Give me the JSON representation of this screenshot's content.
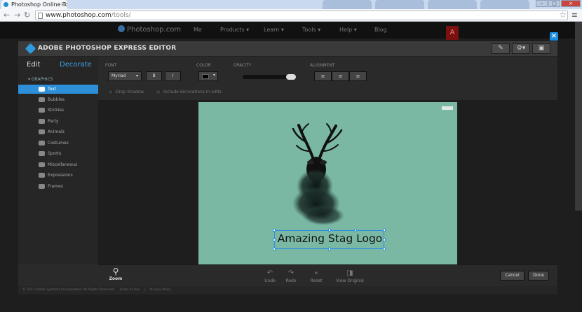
{
  "browser": {
    "tab_title": "Photoshop Online Tools",
    "url_host": "www.photoshop.com",
    "url_path": "/tools/",
    "back_icon": "back-arrow-icon",
    "forward_icon": "forward-arrow-icon",
    "reload_icon": "reload-icon"
  },
  "site_nav": {
    "logo": "Photoshop.com",
    "items": [
      "Me",
      "Products ▾",
      "Learn ▾",
      "Tools ▾",
      "Help ▾",
      "Blog"
    ]
  },
  "editor": {
    "title": "ADOBE PHOTOSHOP EXPRESS EDITOR",
    "tabs": {
      "edit": "Edit",
      "decorate": "Decorate"
    },
    "group": "▾ GRAPHICS",
    "categories": [
      "Text",
      "Bubbles",
      "Stickies",
      "Party",
      "Animals",
      "Costumes",
      "Sports",
      "Miscellaneous",
      "Expressions",
      "Frames"
    ],
    "selected_category": "Text"
  },
  "options": {
    "font_label": "FONT",
    "font_value": "Myriad",
    "bold": "B",
    "italic": "I",
    "color_label": "COLOR",
    "text_color": "#000000",
    "opacity_label": "OPACITY",
    "opacity_fraction": 1.0,
    "alignment_label": "ALIGNMENT",
    "drop_shadow": "Drop Shadow",
    "include_decorations": "Include decorations in edits"
  },
  "canvas": {
    "background_color": "#7ab8a4",
    "text": "Amazing Stag Logo"
  },
  "bottom": {
    "zoom": "Zoom",
    "undo": "Undo",
    "redo": "Redo",
    "reset": "Reset",
    "view_original": "View Original",
    "cancel": "Cancel",
    "done": "Done"
  },
  "footer": {
    "copyright": "© 2013 Adobe Systems Incorporated. All Rights Reserved.",
    "terms": "Terms of Use",
    "separator": "|",
    "privacy": "Privacy Policy"
  },
  "colors": {
    "accent": "#2d8fd8",
    "decorate_tab": "#3fa2e4"
  }
}
